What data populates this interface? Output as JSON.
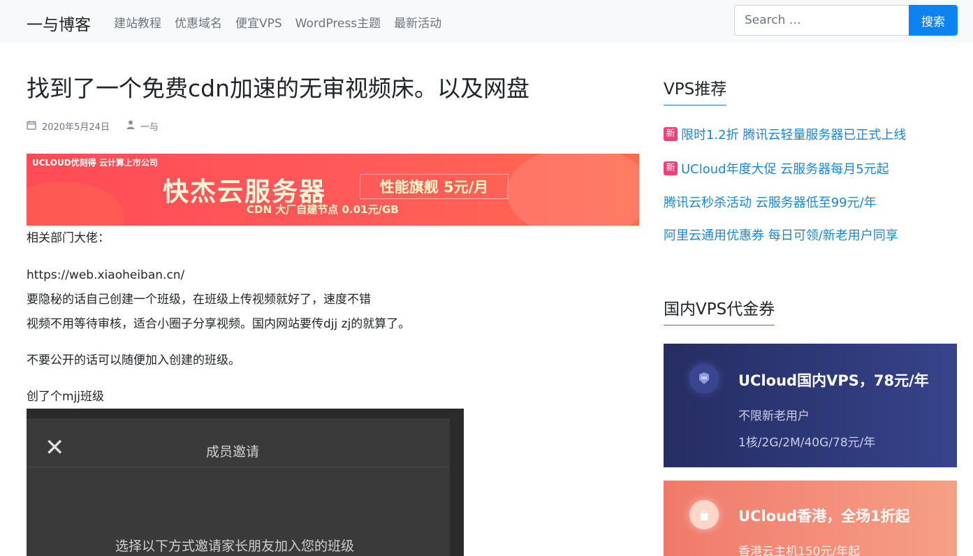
{
  "header": {
    "brand": "一与博客",
    "nav": [
      "建站教程",
      "优惠域名",
      "便宜VPS",
      "WordPress主题",
      "最新活动"
    ],
    "search_placeholder": "Search …",
    "search_button": "搜索"
  },
  "post": {
    "title": "找到了一个免费cdn加速的无审视频床。以及网盘",
    "date": "2020年5月24日",
    "author": "一与",
    "banner": {
      "tag": "UCLOUD优刻得  云计算上市公司",
      "headline": "快杰云服务器",
      "box": "性能旗舰  5元/月",
      "sub": "CDN 大厂自建节点 0.01元/GB"
    },
    "p1": "相关部门大佬：",
    "p2_lines": [
      "https://web.xiaoheiban.cn/",
      "要隐秘的话自己创建一个班级，在班级上传视频就好了，速度不错",
      "视频不用等待审核，适合小圈子分享视频。国内网站要传djj zj的就算了。"
    ],
    "p3": "不要公开的话可以随便加入创建的班级。",
    "p4": "创了个mjj班级",
    "screenshot": {
      "close": "✕",
      "title": "成员邀请",
      "message": "选择以下方式邀请家长朋友加入您的班级"
    }
  },
  "sidebar": {
    "vps_heading": "VPS推荐",
    "badge": "新",
    "links": [
      {
        "text": "限时1.2折 腾讯云轻量服务器已正式上线",
        "new": true
      },
      {
        "text": "UCloud年度大促 云服务器每月5元起",
        "new": true
      },
      {
        "text": "腾讯云秒杀活动 云服务器低至99元/年",
        "new": false
      },
      {
        "text": "阿里云通用优惠券 每日可领/新老用户同享",
        "new": false
      }
    ],
    "voucher_heading": "国内VPS代金券",
    "cards": [
      {
        "title": "UCloud国内VPS，78元/年",
        "line1": "不限新老用户",
        "line2": "1核/2G/2M/40G/78元/年"
      },
      {
        "title": "UCloud香港，全场1折起",
        "line1": "香港云主机150元/年起"
      }
    ]
  }
}
